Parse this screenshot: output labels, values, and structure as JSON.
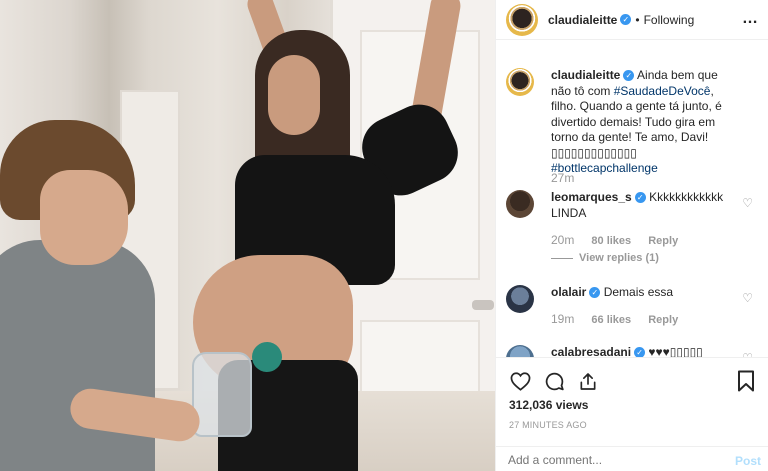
{
  "header": {
    "username": "claudialeitte",
    "separator": "•",
    "follow_status": "Following",
    "more_icon": "…"
  },
  "caption": {
    "username": "claudialeitte",
    "text_before": "Ainda bem que não tô com ",
    "hashtag1": "#SaudadeDeVocê",
    "text_after": ", filho. Quando a gente tá junto, é divertido demais! Tudo gira em torno da gente! Te amo, Davi! ▯▯▯▯▯▯▯▯▯▯▯▯▯",
    "hashtag2": "#bottlecapchallenge",
    "time": "27m"
  },
  "comments": [
    {
      "username": "leomarques_s",
      "text": "Kkkkkkkkkkkk LINDA",
      "time": "20m",
      "likes": "80 likes",
      "reply": "Reply",
      "view_replies": "View replies (1)"
    },
    {
      "username": "olalair",
      "text": "Demais essa",
      "time": "19m",
      "likes": "66 likes",
      "reply": "Reply"
    },
    {
      "username": "calabresadani",
      "text": "♥♥♥▯▯▯▯▯"
    }
  ],
  "actions": {
    "views": "312,036 views",
    "posted_ago": "27 MINUTES AGO"
  },
  "add_comment": {
    "placeholder": "Add a comment...",
    "post_label": "Post"
  },
  "colors": {
    "verified": "#3897f0",
    "link": "#003569",
    "post_disabled": "#b2dffc",
    "muted": "#999999"
  }
}
